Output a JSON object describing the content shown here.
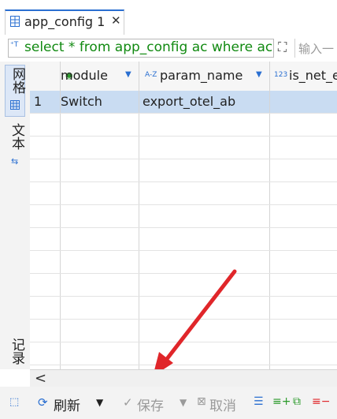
{
  "tab": {
    "title": "app_config 1",
    "close": "✕"
  },
  "sql": {
    "query": "select * from app_config ac where ac",
    "filter_placeholder": "输入一"
  },
  "side": {
    "grid_label": "网格",
    "text_label": "文本",
    "record_label": "记录"
  },
  "columns": [
    {
      "name": "module",
      "icon": "◉"
    },
    {
      "name": "param_name",
      "icon": "A-Z"
    },
    {
      "name": "is_net_e",
      "icon": "123"
    }
  ],
  "rows": [
    {
      "num": "1",
      "module": "Switch",
      "param_name": "export_otel_ab"
    }
  ],
  "toolbar": {
    "refresh": "刷新",
    "save": "保存",
    "cancel": "取消"
  },
  "nav": {
    "left_arrow": "<"
  },
  "colors": {
    "accent": "#2a6fd1",
    "selected_row": "#c9dcf2",
    "sql_text": "#118a11",
    "annotation_arrow": "#e0262a"
  }
}
